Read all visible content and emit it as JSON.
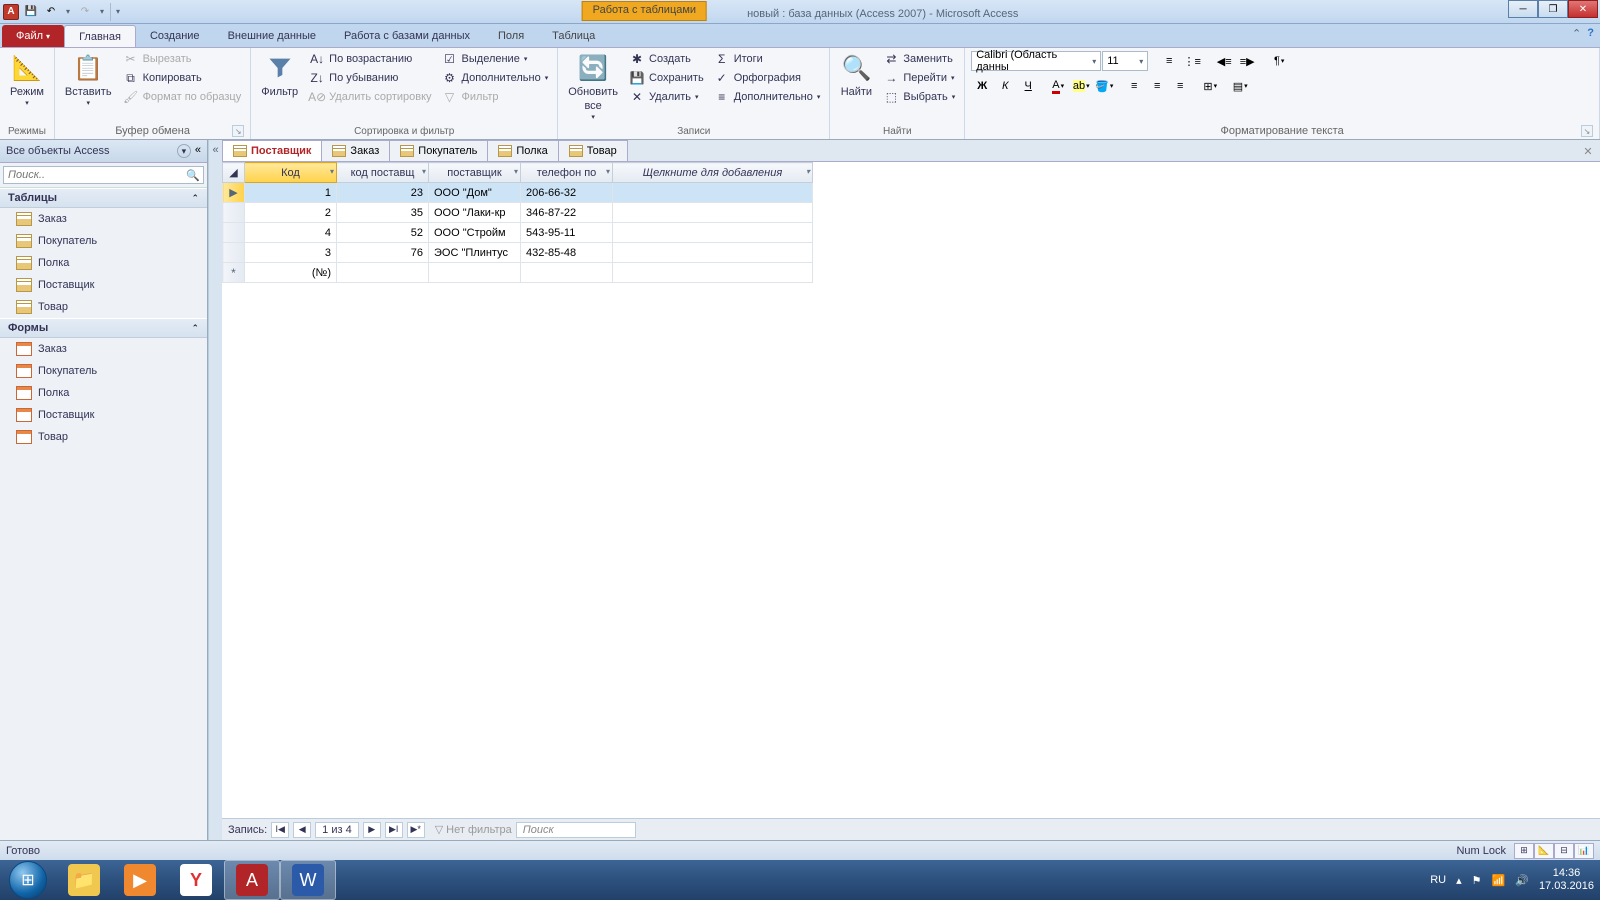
{
  "title": {
    "context_tab": "Работа с таблицами",
    "document": "новый : база данных (Access 2007) - Microsoft Access"
  },
  "ribbon_tabs": {
    "file": "Файл",
    "home": "Главная",
    "create": "Создание",
    "external": "Внешние данные",
    "dbtools": "Работа с базами данных",
    "fields": "Поля",
    "table": "Таблица"
  },
  "ribbon": {
    "view": "Режим",
    "view_group": "Режимы",
    "paste": "Вставить",
    "cut": "Вырезать",
    "copy": "Копировать",
    "fmtpaint": "Формат по образцу",
    "clipboard_group": "Буфер обмена",
    "filter": "Фильтр",
    "asc": "По возрастанию",
    "desc": "По убыванию",
    "clearsort": "Удалить сортировку",
    "selection": "Выделение",
    "advanced": "Дополнительно",
    "togglefilter": "Фильтр",
    "sort_group": "Сортировка и фильтр",
    "refresh": "Обновить",
    "refresh2": "все",
    "new": "Создать",
    "save": "Сохранить",
    "delete": "Удалить",
    "totals": "Итоги",
    "spelling": "Орфография",
    "more": "Дополнительно",
    "records_group": "Записи",
    "find": "Найти",
    "replace": "Заменить",
    "goto": "Перейти",
    "select": "Выбрать",
    "find_group": "Найти",
    "font": "Calibri (Область данны",
    "size": "11",
    "fmt_group": "Форматирование текста"
  },
  "navpane": {
    "header": "Все объекты Access",
    "search_placeholder": "Поиск..",
    "tables_section": "Таблицы",
    "forms_section": "Формы",
    "tables": [
      "Заказ",
      "Покупатель",
      "Полка",
      "Поставщик",
      "Товар"
    ],
    "forms": [
      "Заказ",
      "Покупатель",
      "Полка",
      "Поставщик",
      "Товар"
    ]
  },
  "doc_tabs": [
    "Поставщик",
    "Заказ",
    "Покупатель",
    "Полка",
    "Товар"
  ],
  "grid": {
    "columns": [
      "Код",
      "код поставщ",
      "поставщик",
      "телефон по"
    ],
    "add_column": "Щелкните для добавления",
    "rows": [
      {
        "id": "1",
        "code": "23",
        "name": "ООО \"Дом\"",
        "phone": "206-66-32"
      },
      {
        "id": "2",
        "code": "35",
        "name": "ООО \"Лаки-кр",
        "phone": "346-87-22"
      },
      {
        "id": "4",
        "code": "52",
        "name": "ООО \"Стройм",
        "phone": "543-95-11"
      },
      {
        "id": "3",
        "code": "76",
        "name": "ЭОС \"Плинтус",
        "phone": "432-85-48"
      }
    ],
    "new_id": "(№)"
  },
  "recnav": {
    "label": "Запись:",
    "pos": "1 из 4",
    "nofilter": "Нет фильтра",
    "search": "Поиск"
  },
  "status": {
    "ready": "Готово",
    "numlock": "Num Lock"
  },
  "tray": {
    "lang": "RU",
    "time": "14:36",
    "date": "17.03.2016"
  }
}
